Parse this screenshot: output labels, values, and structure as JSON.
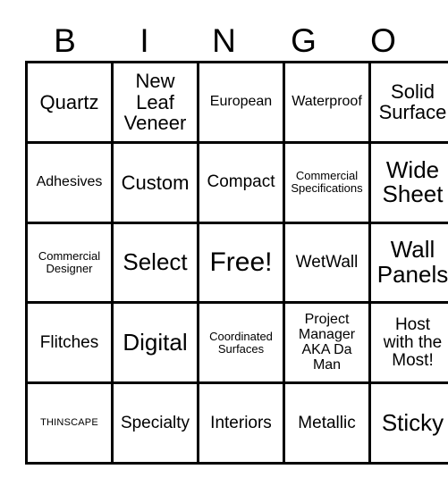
{
  "card": {
    "title": "BINGO",
    "header_letters": [
      "B",
      "I",
      "N",
      "G",
      "O"
    ],
    "rows": 5,
    "columns": 5,
    "text_color": "#000000",
    "background_color": "#ffffff",
    "border_color": "#000000",
    "cells": [
      [
        {
          "text": "Quartz",
          "size": "lg"
        },
        {
          "text": "New\nLeaf\nVeneer",
          "size": "lg"
        },
        {
          "text": "European",
          "size": "sm"
        },
        {
          "text": "Waterproof",
          "size": "sm"
        },
        {
          "text": "Solid\nSurface",
          "size": "lg"
        }
      ],
      [
        {
          "text": "Adhesives",
          "size": "sm"
        },
        {
          "text": "Custom",
          "size": "lg"
        },
        {
          "text": "Compact",
          "size": "md"
        },
        {
          "text": "Commercial\nSpecifications",
          "size": "xs"
        },
        {
          "text": "Wide\nSheet",
          "size": "xl"
        }
      ],
      [
        {
          "text": "Commercial\nDesigner",
          "size": "xs"
        },
        {
          "text": "Select",
          "size": "xl"
        },
        {
          "text": "Free!",
          "size": "xxl"
        },
        {
          "text": "WetWall",
          "size": "md"
        },
        {
          "text": "Wall\nPanels",
          "size": "xl"
        }
      ],
      [
        {
          "text": "Flitches",
          "size": "md"
        },
        {
          "text": "Digital",
          "size": "xl"
        },
        {
          "text": "Coordinated\nSurfaces",
          "size": "xs"
        },
        {
          "text": "Project\nManager\nAKA Da\nMan",
          "size": "sm"
        },
        {
          "text": "Host\nwith the\nMost!",
          "size": "md"
        }
      ],
      [
        {
          "text": "THINSCAPE",
          "size": "xxs"
        },
        {
          "text": "Specialty",
          "size": "md"
        },
        {
          "text": "Interiors",
          "size": "md"
        },
        {
          "text": "Metallic",
          "size": "md"
        },
        {
          "text": "Sticky",
          "size": "xl"
        }
      ]
    ]
  }
}
